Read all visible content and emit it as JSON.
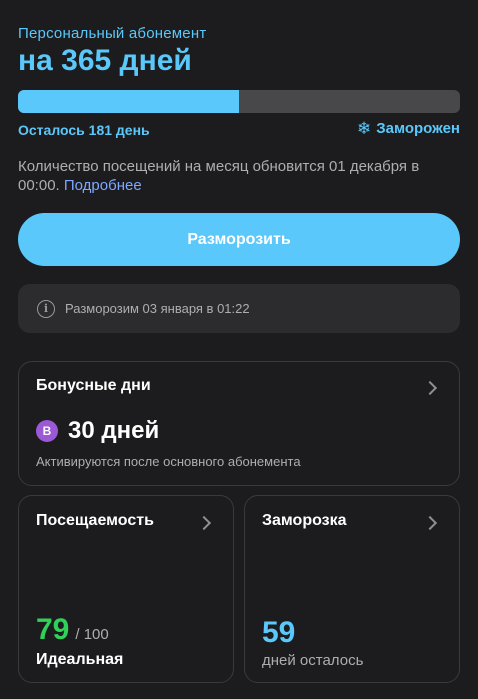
{
  "subscription": {
    "subtitle": "Персональный абонемент",
    "title": "на 365 дней",
    "progress_remaining_fraction": 0.5,
    "remaining_label": "Осталось 181 день",
    "status_label": "Заморожен",
    "status_icon": "snowflake-icon"
  },
  "visits_info": {
    "text": "Количество посещений на месяц обновится 01 декабря в 00:00.",
    "link": "Подробнее"
  },
  "unfreeze_button": {
    "label": "Разморозить"
  },
  "notice": {
    "icon": "info-icon",
    "text": "Разморозим 03 января в 01:22"
  },
  "bonus": {
    "title": "Бонусные дни",
    "badge": "B",
    "days": "30 дней",
    "note": "Активируются после основного абонемента"
  },
  "attendance": {
    "title": "Посещаемость",
    "value": "79",
    "max": "/ 100",
    "label": "Идеальная"
  },
  "freeze": {
    "title": "Заморозка",
    "value": "59",
    "label": "дней осталось"
  },
  "colors": {
    "accent": "#5ac8fa",
    "success": "#30d158",
    "link": "#7ea7ff",
    "badge": "#9b59d6"
  }
}
